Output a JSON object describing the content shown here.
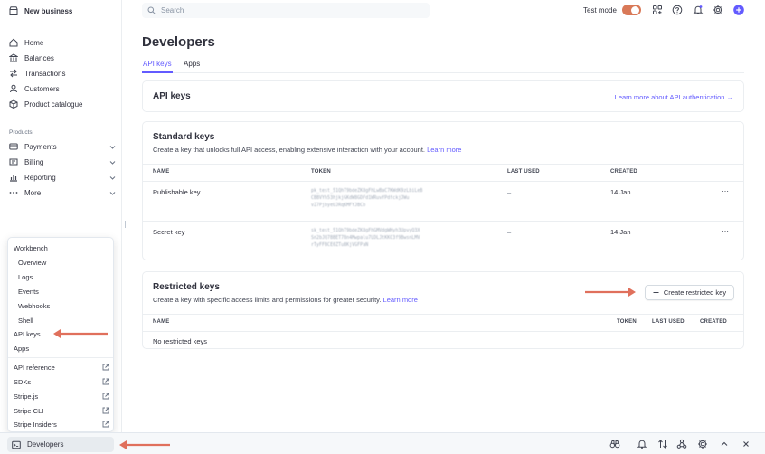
{
  "sidebar": {
    "business_name": "New business",
    "items": [
      {
        "label": "Home"
      },
      {
        "label": "Balances"
      },
      {
        "label": "Transactions"
      },
      {
        "label": "Customers"
      },
      {
        "label": "Product catalogue"
      }
    ],
    "products_label": "Products",
    "product_items": [
      {
        "label": "Payments"
      },
      {
        "label": "Billing"
      },
      {
        "label": "Reporting"
      },
      {
        "label": "More"
      }
    ]
  },
  "dev_menu": {
    "header": "Workbench",
    "workbench_items": [
      "Overview",
      "Logs",
      "Events",
      "Webhooks",
      "Shell"
    ],
    "items": [
      "API keys",
      "Apps"
    ],
    "external_items": [
      "API reference",
      "SDKs",
      "Stripe.js",
      "Stripe CLI",
      "Stripe Insiders"
    ]
  },
  "bottombar": {
    "developers_label": "Developers"
  },
  "topbar": {
    "search_placeholder": "Search",
    "test_mode_label": "Test mode",
    "test_mode_on": true
  },
  "page": {
    "title": "Developers",
    "tabs": [
      {
        "label": "API keys",
        "active": true
      },
      {
        "label": "Apps",
        "active": false
      }
    ]
  },
  "api_keys_card": {
    "title": "API keys",
    "link": "Learn more about API authentication →"
  },
  "standard_keys": {
    "title": "Standard keys",
    "description": "Create a key that unlocks full API access, enabling extensive interaction with your account.",
    "link": "Learn more",
    "columns": [
      "NAME",
      "TOKEN",
      "LAST USED",
      "CREATED"
    ],
    "rows": [
      {
        "name": "Publishable key",
        "token": "pk_test_51QhT9bdeZK8gFhLwBaC7KWdK9zLbiLeB\nCBBVYh53hjkjGKdW8GDFd1WRuvYPdfckjJWu\nvZ7PjbyeUJRqKMFYJBCb",
        "last_used": "–",
        "created": "14 Jan",
        "menu": "⋯"
      },
      {
        "name": "Secret key",
        "token": "sk_test_51QhT9bdeZK8gFhGMVdgWHyh3UpvyQ3X\nSn2bJQ7BBET7Bn4Mwpalu7LDLJtKKC3f9BwsnLMV\nrTyFFBCE0ZTuBKjVGFPaN",
        "last_used": "–",
        "created": "14 Jan",
        "menu": "⋯"
      }
    ]
  },
  "restricted_keys": {
    "title": "Restricted keys",
    "description": "Create a key with specific access limits and permissions for greater security.",
    "link": "Learn more",
    "create_button": "Create restricted key",
    "columns": [
      "NAME",
      "TOKEN",
      "LAST USED",
      "CREATED"
    ],
    "empty": "No restricted keys"
  },
  "colors": {
    "accent": "#635bff",
    "annotation_arrow": "#e0705c",
    "toggle": "#d97958"
  }
}
